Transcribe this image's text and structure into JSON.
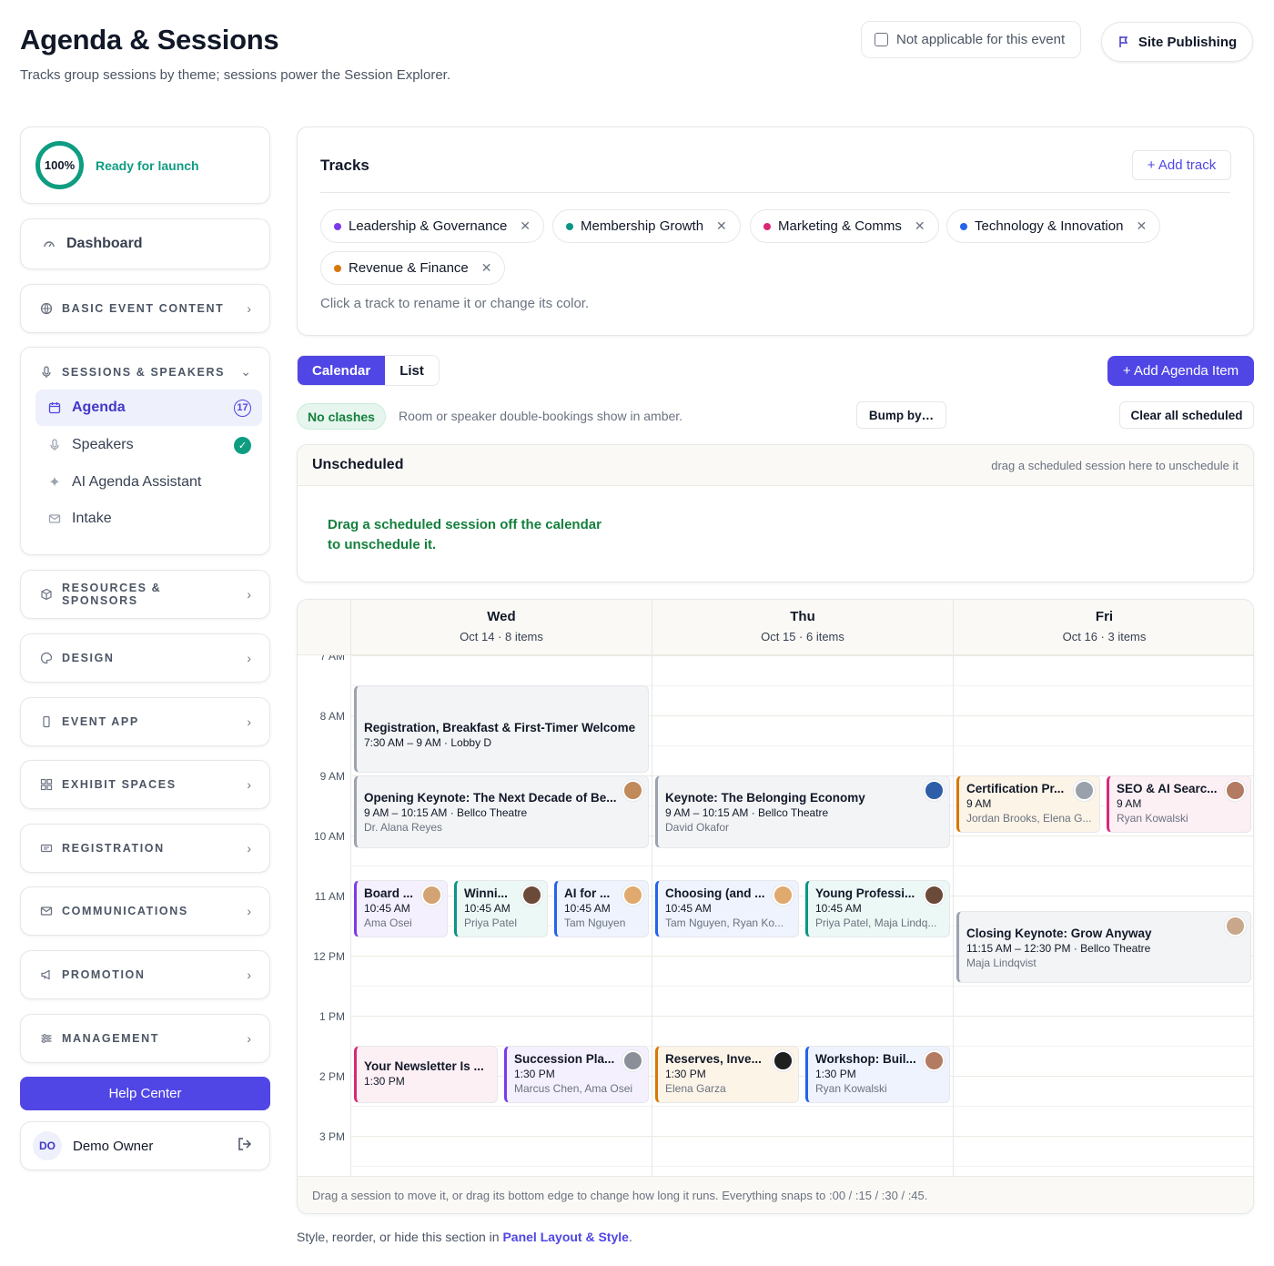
{
  "header": {
    "title": "Agenda & Sessions",
    "subtitle": "Tracks group sessions by theme; sessions power the Session Explorer.",
    "not_applicable_label": "Not applicable for this event",
    "site_publishing_label": "Site Publishing"
  },
  "sidebar": {
    "launch": {
      "percent": "100%",
      "label": "Ready for launch",
      "progress": 1.0
    },
    "dashboard_label": "Dashboard",
    "basic_event_content": "BASIC EVENT CONTENT",
    "sessions_speakers": {
      "label": "SESSIONS & SPEAKERS",
      "items": [
        {
          "label": "Agenda",
          "badge": "17"
        },
        {
          "label": "Speakers"
        },
        {
          "label": "AI Agenda Assistant"
        },
        {
          "label": "Intake"
        }
      ]
    },
    "sections": [
      "RESOURCES & SPONSORS",
      "DESIGN",
      "EVENT APP",
      "EXHIBIT SPACES",
      "REGISTRATION",
      "COMMUNICATIONS",
      "PROMOTION",
      "MANAGEMENT"
    ],
    "help_center": "Help Center",
    "user": {
      "initials": "DO",
      "name": "Demo Owner"
    }
  },
  "tracks": {
    "title": "Tracks",
    "add_label": "+ Add track",
    "items": [
      {
        "name": "Leadership & Governance",
        "color": "#7c3aed"
      },
      {
        "name": "Membership Growth",
        "color": "#0d9488"
      },
      {
        "name": "Marketing & Comms",
        "color": "#db2777"
      },
      {
        "name": "Technology & Innovation",
        "color": "#2563eb"
      },
      {
        "name": "Revenue & Finance",
        "color": "#d97706"
      }
    ],
    "hint": "Click a track to rename it or change its color."
  },
  "toolbar": {
    "view_calendar": "Calendar",
    "view_list": "List",
    "add_agenda_item": "+ Add Agenda Item",
    "no_clashes": "No clashes",
    "clash_hint": "Room or speaker double-bookings show in amber.",
    "bump_by": "Bump by…",
    "clear_all": "Clear all scheduled"
  },
  "unscheduled": {
    "title": "Unscheduled",
    "hint": "drag a scheduled session here to unschedule it",
    "message": "Drag a scheduled session off the calendar to unschedule it."
  },
  "calendar": {
    "days": [
      {
        "name": "Wed",
        "date": "Oct 14 · 8 items"
      },
      {
        "name": "Thu",
        "date": "Oct 15 · 6 items"
      },
      {
        "name": "Fri",
        "date": "Oct 16 · 3 items"
      }
    ],
    "hours": [
      "7 AM",
      "8 AM",
      "9 AM",
      "10 AM",
      "11 AM",
      "12 PM",
      "1 PM",
      "2 PM",
      "3 PM"
    ],
    "footer": "Drag a session to move it, or drag its bottom edge to change how long it runs. Everything snaps to :00 / :15 / :30 / :45.",
    "events": [
      {
        "title": "Registration, Breakfast & First-Timer Welcome",
        "meta": "7:30 AM – 9 AM · Lobby D",
        "sub": "",
        "track": "none"
      },
      {
        "title": "Opening Keynote: The Next Decade of Be...",
        "meta": "9 AM – 10:15 AM · Bellco Theatre",
        "sub": "Dr. Alana Reyes",
        "track": "none"
      },
      {
        "title": "Keynote: The Belonging Economy",
        "meta": "9 AM – 10:15 AM · Bellco Theatre",
        "sub": "David Okafor",
        "track": "none"
      },
      {
        "title": "Certification Pr...",
        "meta": "9 AM",
        "sub": "Jordan Brooks, Elena G...",
        "track": "revenue"
      },
      {
        "title": "SEO & AI Searc...",
        "meta": "9 AM",
        "sub": "Ryan Kowalski",
        "track": "marketing"
      },
      {
        "title": "Board ...",
        "meta": "10:45 AM",
        "sub": "Ama Osei",
        "track": "leadership"
      },
      {
        "title": "Winni...",
        "meta": "10:45 AM",
        "sub": "Priya Patel",
        "track": "membership"
      },
      {
        "title": "AI for ...",
        "meta": "10:45 AM",
        "sub": "Tam Nguyen",
        "track": "technology"
      },
      {
        "title": "Choosing (and ...",
        "meta": "10:45 AM",
        "sub": "Tam Nguyen, Ryan Ko...",
        "track": "technology"
      },
      {
        "title": "Young Professi...",
        "meta": "10:45 AM",
        "sub": "Priya Patel, Maja Lindq...",
        "track": "membership"
      },
      {
        "title": "Closing Keynote: Grow Anyway",
        "meta": "11:15 AM – 12:30 PM · Bellco Theatre",
        "sub": "Maja Lindqvist",
        "track": "none"
      },
      {
        "title": "Your Newsletter Is ...",
        "meta": "1:30 PM",
        "sub": "",
        "track": "marketing"
      },
      {
        "title": "Succession Pla...",
        "meta": "1:30 PM",
        "sub": "Marcus Chen, Ama Osei",
        "track": "leadership"
      },
      {
        "title": "Reserves, Inve...",
        "meta": "1:30 PM",
        "sub": "Elena Garza",
        "track": "revenue"
      },
      {
        "title": "Workshop: Buil...",
        "meta": "1:30 PM",
        "sub": "Ryan Kowalski",
        "track": "technology"
      }
    ]
  },
  "footnote": {
    "prefix": "Style, reorder, or hide this section in ",
    "link": "Panel Layout & Style",
    "suffix": "."
  }
}
